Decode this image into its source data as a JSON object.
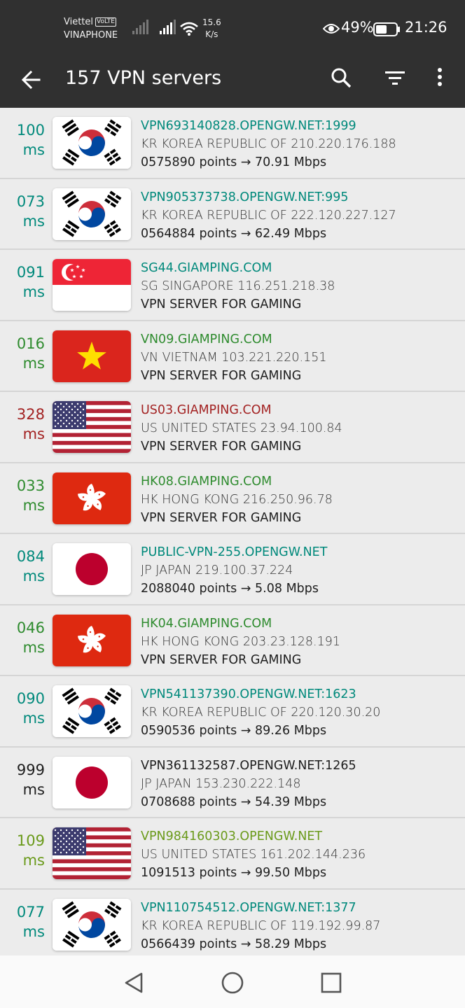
{
  "status_bar": {
    "carrier_1": "Viettel",
    "volte": "VoLTE",
    "carrier_2": "VINAPHONE",
    "net_speed_value": "15.6",
    "net_speed_unit": "K/s",
    "battery_percent": "49%",
    "time": "21:26"
  },
  "app_bar": {
    "title": "157 VPN servers",
    "back_icon": "arrow-left-icon",
    "search_icon": "search-icon",
    "filter_icon": "filter-sort-icon",
    "more_icon": "more-vert-icon"
  },
  "colors": {
    "bar_bg": "#303030",
    "teal": "#00897b",
    "green": "#2e8b2e",
    "red": "#a32222",
    "olive": "#6a9a1a",
    "black": "#1e1e1e"
  },
  "servers": [
    {
      "ping": "100",
      "unit": "ms",
      "flag": "kr",
      "host": "VPN693140828.OPENGW.NET:1999",
      "location": "KR KOREA REPUBLIC OF 210.220.176.188",
      "detail": "0575890 points → 70.91 Mbps",
      "color": "#00897b"
    },
    {
      "ping": "073",
      "unit": "ms",
      "flag": "kr",
      "host": "VPN905373738.OPENGW.NET:995",
      "location": "KR KOREA REPUBLIC OF 222.120.227.127",
      "detail": "0564884 points → 62.49 Mbps",
      "color": "#00897b"
    },
    {
      "ping": "091",
      "unit": "ms",
      "flag": "sg",
      "host": "SG44.GIAMPING.COM",
      "location": "SG SINGAPORE 116.251.218.38",
      "detail": "VPN SERVER FOR GAMING",
      "color": "#00897b"
    },
    {
      "ping": "016",
      "unit": "ms",
      "flag": "vn",
      "host": "VN09.GIAMPING.COM",
      "location": "VN VIETNAM 103.221.220.151",
      "detail": "VPN SERVER FOR GAMING",
      "color": "#2e8b2e"
    },
    {
      "ping": "328",
      "unit": "ms",
      "flag": "us",
      "host": "US03.GIAMPING.COM",
      "location": "US UNITED STATES 23.94.100.84",
      "detail": "VPN SERVER FOR GAMING",
      "color": "#a32222"
    },
    {
      "ping": "033",
      "unit": "ms",
      "flag": "hk",
      "host": "HK08.GIAMPING.COM",
      "location": "HK HONG KONG 216.250.96.78",
      "detail": "VPN SERVER FOR GAMING",
      "color": "#2e8b2e"
    },
    {
      "ping": "084",
      "unit": "ms",
      "flag": "jp",
      "host": "PUBLIC-VPN-255.OPENGW.NET",
      "location": "JP JAPAN 219.100.37.224",
      "detail": "2088040 points → 5.08 Mbps",
      "color": "#00897b"
    },
    {
      "ping": "046",
      "unit": "ms",
      "flag": "hk",
      "host": "HK04.GIAMPING.COM",
      "location": "HK HONG KONG 203.23.128.191",
      "detail": "VPN SERVER FOR GAMING",
      "color": "#2e8b2e"
    },
    {
      "ping": "090",
      "unit": "ms",
      "flag": "kr",
      "host": "VPN541137390.OPENGW.NET:1623",
      "location": "KR KOREA REPUBLIC OF 220.120.30.20",
      "detail": "0590536 points → 89.26 Mbps",
      "color": "#00897b"
    },
    {
      "ping": "999",
      "unit": "ms",
      "flag": "jp",
      "host": "VPN361132587.OPENGW.NET:1265",
      "location": "JP JAPAN 153.230.222.148",
      "detail": "0708688 points → 54.39 Mbps",
      "color": "#1e1e1e"
    },
    {
      "ping": "109",
      "unit": "ms",
      "flag": "us",
      "host": "VPN984160303.OPENGW.NET",
      "location": "US UNITED STATES 161.202.144.236",
      "detail": "1091513 points → 99.50 Mbps",
      "color": "#6a9a1a"
    },
    {
      "ping": "077",
      "unit": "ms",
      "flag": "kr",
      "host": "VPN110754512.OPENGW.NET:1377",
      "location": "KR KOREA REPUBLIC OF 119.192.99.87",
      "detail": "0566439 points → 58.29 Mbps",
      "color": "#00897b"
    }
  ],
  "nav_bar": {
    "back_icon": "triangle-back-icon",
    "home_icon": "circle-home-icon",
    "recents_icon": "square-recents-icon"
  }
}
